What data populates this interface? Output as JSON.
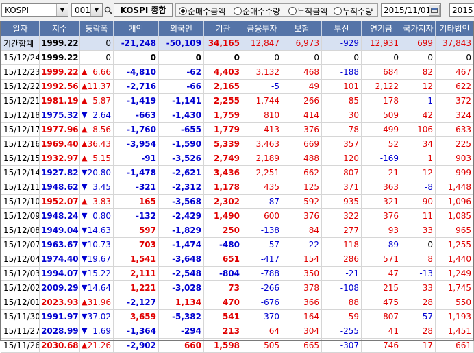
{
  "toolbar": {
    "market": "KOSPI",
    "code": "001",
    "index_name": "KOSPI 종합",
    "radios": [
      {
        "label": "순매수금액",
        "selected": true
      },
      {
        "label": "순매수수량",
        "selected": false
      },
      {
        "label": "누적금액",
        "selected": false
      },
      {
        "label": "누적수량",
        "selected": false
      }
    ],
    "start_date": "2015/11/01",
    "range_sep": "-",
    "end_date": "2015"
  },
  "table": {
    "columns": [
      "일자",
      "지수",
      "등락폭",
      "개인",
      "외국인",
      "기관",
      "금융투자",
      "보험",
      "투신",
      "연기금",
      "국가지자",
      "기타법인"
    ],
    "summary": {
      "date": "기간합계",
      "index": "1999.22",
      "change": "0",
      "indiv": "-21,248",
      "foreign": "-50,109",
      "inst": "34,165",
      "fin": "12,847",
      "ins": "6,973",
      "trust": "-929",
      "pension": "12,931",
      "gov": "699",
      "etc": "37,843"
    },
    "rows": [
      {
        "date": "15/12/24",
        "index": "1999.22",
        "dir": "flat",
        "change": "0",
        "indiv": "0",
        "foreign": "0",
        "inst": "0",
        "fin": "0",
        "ins": "0",
        "trust": "0",
        "pension": "0",
        "gov": "0",
        "etc": "0"
      },
      {
        "date": "15/12/23",
        "index": "1999.22",
        "dir": "up",
        "change": "6.66",
        "indiv": "-4,810",
        "foreign": "-62",
        "inst": "4,403",
        "fin": "3,132",
        "ins": "468",
        "trust": "-188",
        "pension": "684",
        "gov": "82",
        "etc": "467"
      },
      {
        "date": "15/12/22",
        "index": "1992.56",
        "dir": "up",
        "change": "11.37",
        "indiv": "-2,716",
        "foreign": "-66",
        "inst": "2,165",
        "fin": "-5",
        "ins": "49",
        "trust": "101",
        "pension": "2,122",
        "gov": "12",
        "etc": "622"
      },
      {
        "date": "15/12/21",
        "index": "1981.19",
        "dir": "up",
        "change": "5.87",
        "indiv": "-1,419",
        "foreign": "-1,141",
        "inst": "2,255",
        "fin": "1,744",
        "ins": "266",
        "trust": "85",
        "pension": "178",
        "gov": "-1",
        "etc": "372"
      },
      {
        "date": "15/12/18",
        "index": "1975.32",
        "dir": "dn",
        "change": "2.64",
        "indiv": "-663",
        "foreign": "-1,430",
        "inst": "1,759",
        "fin": "810",
        "ins": "414",
        "trust": "30",
        "pension": "509",
        "gov": "42",
        "etc": "324"
      },
      {
        "date": "15/12/17",
        "index": "1977.96",
        "dir": "up",
        "change": "8.56",
        "indiv": "-1,760",
        "foreign": "-655",
        "inst": "1,779",
        "fin": "413",
        "ins": "376",
        "trust": "78",
        "pension": "499",
        "gov": "106",
        "etc": "633"
      },
      {
        "date": "15/12/16",
        "index": "1969.40",
        "dir": "up",
        "change": "36.43",
        "indiv": "-3,954",
        "foreign": "-1,590",
        "inst": "5,339",
        "fin": "3,463",
        "ins": "669",
        "trust": "357",
        "pension": "52",
        "gov": "34",
        "etc": "225"
      },
      {
        "date": "15/12/15",
        "index": "1932.97",
        "dir": "up",
        "change": "5.15",
        "indiv": "-91",
        "foreign": "-3,526",
        "inst": "2,749",
        "fin": "2,189",
        "ins": "488",
        "trust": "120",
        "pension": "-169",
        "gov": "1",
        "etc": "903"
      },
      {
        "date": "15/12/14",
        "index": "1927.82",
        "dir": "dn",
        "change": "20.80",
        "indiv": "-1,478",
        "foreign": "-2,621",
        "inst": "3,436",
        "fin": "2,251",
        "ins": "662",
        "trust": "807",
        "pension": "21",
        "gov": "12",
        "etc": "999"
      },
      {
        "date": "15/12/11",
        "index": "1948.62",
        "dir": "dn",
        "change": "3.45",
        "indiv": "-321",
        "foreign": "-2,312",
        "inst": "1,178",
        "fin": "435",
        "ins": "125",
        "trust": "371",
        "pension": "363",
        "gov": "-8",
        "etc": "1,448"
      },
      {
        "date": "15/12/10",
        "index": "1952.07",
        "dir": "up",
        "change": "3.83",
        "indiv": "165",
        "foreign": "-3,568",
        "inst": "2,302",
        "fin": "-87",
        "ins": "592",
        "trust": "935",
        "pension": "321",
        "gov": "90",
        "etc": "1,096"
      },
      {
        "date": "15/12/09",
        "index": "1948.24",
        "dir": "dn",
        "change": "0.80",
        "indiv": "-132",
        "foreign": "-2,429",
        "inst": "1,490",
        "fin": "600",
        "ins": "376",
        "trust": "322",
        "pension": "376",
        "gov": "11",
        "etc": "1,085"
      },
      {
        "date": "15/12/08",
        "index": "1949.04",
        "dir": "dn",
        "change": "14.63",
        "indiv": "597",
        "foreign": "-1,829",
        "inst": "250",
        "fin": "-138",
        "ins": "84",
        "trust": "277",
        "pension": "93",
        "gov": "33",
        "etc": "965"
      },
      {
        "date": "15/12/07",
        "index": "1963.67",
        "dir": "dn",
        "change": "10.73",
        "indiv": "703",
        "foreign": "-1,474",
        "inst": "-480",
        "fin": "-57",
        "ins": "-22",
        "trust": "118",
        "pension": "-89",
        "gov": "0",
        "etc": "1,255"
      },
      {
        "date": "15/12/04",
        "index": "1974.40",
        "dir": "dn",
        "change": "19.67",
        "indiv": "1,541",
        "foreign": "-3,648",
        "inst": "651",
        "fin": "-417",
        "ins": "154",
        "trust": "286",
        "pension": "571",
        "gov": "8",
        "etc": "1,440"
      },
      {
        "date": "15/12/03",
        "index": "1994.07",
        "dir": "dn",
        "change": "15.22",
        "indiv": "2,111",
        "foreign": "-2,548",
        "inst": "-804",
        "fin": "-788",
        "ins": "350",
        "trust": "-21",
        "pension": "47",
        "gov": "-13",
        "etc": "1,249"
      },
      {
        "date": "15/12/02",
        "index": "2009.29",
        "dir": "dn",
        "change": "14.64",
        "indiv": "1,221",
        "foreign": "-3,028",
        "inst": "73",
        "fin": "-266",
        "ins": "378",
        "trust": "-108",
        "pension": "215",
        "gov": "33",
        "etc": "1,745"
      },
      {
        "date": "15/12/01",
        "index": "2023.93",
        "dir": "up",
        "change": "31.96",
        "indiv": "-2,127",
        "foreign": "1,134",
        "inst": "470",
        "fin": "-676",
        "ins": "366",
        "trust": "88",
        "pension": "475",
        "gov": "28",
        "etc": "550"
      },
      {
        "date": "15/11/30",
        "index": "1991.97",
        "dir": "dn",
        "change": "37.02",
        "indiv": "3,659",
        "foreign": "-5,382",
        "inst": "541",
        "fin": "-370",
        "ins": "164",
        "trust": "59",
        "pension": "807",
        "gov": "-57",
        "etc": "1,193"
      },
      {
        "date": "15/11/27",
        "index": "2028.99",
        "dir": "dn",
        "change": "1.69",
        "indiv": "-1,364",
        "foreign": "-294",
        "inst": "213",
        "fin": "64",
        "ins": "304",
        "trust": "-255",
        "pension": "41",
        "gov": "28",
        "etc": "1,451"
      },
      {
        "date": "15/11/26",
        "index": "2030.68",
        "dir": "up",
        "change": "21.26",
        "indiv": "-2,902",
        "foreign": "660",
        "inst": "1,598",
        "fin": "505",
        "ins": "665",
        "trust": "-307",
        "pension": "746",
        "gov": "17",
        "etc": "661"
      }
    ]
  },
  "colors": {
    "header_bg": "#5574a8",
    "summary_bg": "#d7e1f2",
    "up": "#e00000",
    "down": "#0000d0"
  }
}
